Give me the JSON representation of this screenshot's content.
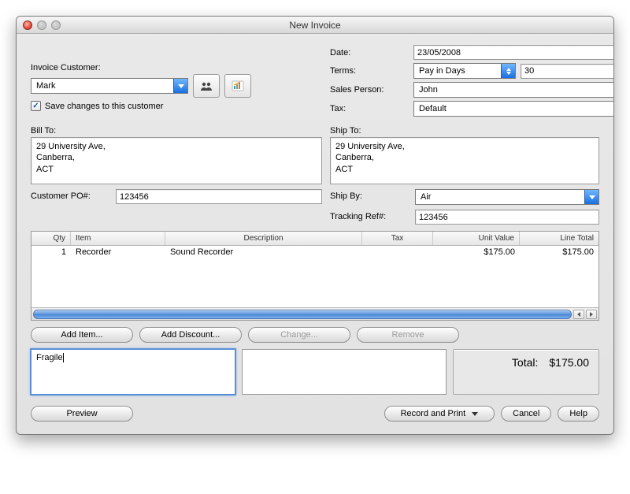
{
  "window": {
    "title": "New Invoice"
  },
  "header_left": {
    "customer_label": "Invoice Customer:",
    "customer_value": "Mark",
    "save_changes_label": "Save changes to this customer",
    "save_changes_checked": true
  },
  "header_right": {
    "date_label": "Date:",
    "date_value": "23/05/2008",
    "terms_label": "Terms:",
    "terms_value": "Pay in Days",
    "terms_days": "30",
    "salesperson_label": "Sales Person:",
    "salesperson_value": "John",
    "tax_label": "Tax:",
    "tax_value": "Default"
  },
  "bill": {
    "label": "Bill To:",
    "address": "29 University Ave,\nCanberra,\nACT"
  },
  "ship": {
    "label": "Ship To:",
    "address": "29 University Ave,\nCanberra,\nACT",
    "ship_by_label": "Ship By:",
    "ship_by_value": "Air",
    "tracking_label": "Tracking Ref#:",
    "tracking_value": "123456"
  },
  "po": {
    "label": "Customer PO#:",
    "value": "123456"
  },
  "table": {
    "headers": {
      "qty": "Qty",
      "item": "Item",
      "desc": "Description",
      "tax": "Tax",
      "unit": "Unit Value",
      "line": "Line Total"
    },
    "rows": [
      {
        "qty": "1",
        "item": "Recorder",
        "desc": "Sound Recorder",
        "tax": "",
        "unit": "$175.00",
        "line": "$175.00"
      }
    ]
  },
  "buttons": {
    "add_item": "Add Item...",
    "add_discount": "Add Discount...",
    "change": "Change...",
    "remove": "Remove",
    "preview": "Preview",
    "record_print": "Record and Print",
    "cancel": "Cancel",
    "help": "Help"
  },
  "notes": {
    "left": "Fragile",
    "right": ""
  },
  "totals": {
    "label": "Total:",
    "value": "$175.00"
  }
}
